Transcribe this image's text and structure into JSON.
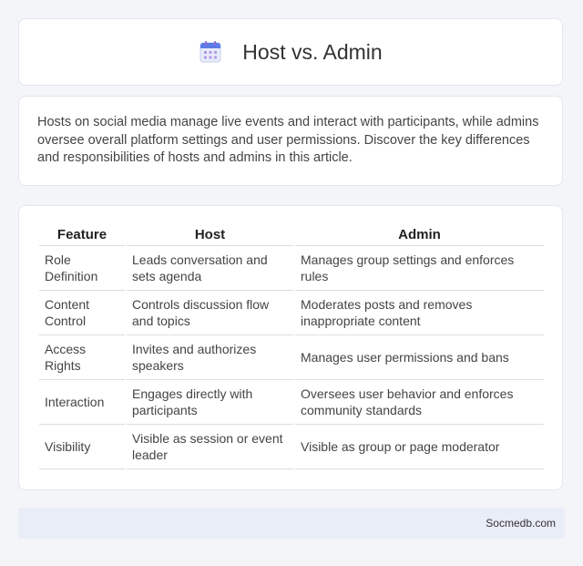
{
  "header": {
    "title": "Host vs. Admin",
    "icon": "calendar-icon"
  },
  "intro": {
    "text": "Hosts on social media manage live events and interact with participants, while admins oversee overall platform settings and user permissions. Discover the key differences and responsibilities of hosts and admins in this article."
  },
  "table": {
    "headers": [
      "Feature",
      "Host",
      "Admin"
    ],
    "rows": [
      [
        "Role Definition",
        "Leads conversation and sets agenda",
        "Manages group settings and enforces rules"
      ],
      [
        "Content Control",
        "Controls discussion flow and topics",
        "Moderates posts and removes inappropriate content"
      ],
      [
        "Access Rights",
        "Invites and authorizes speakers",
        "Manages user permissions and bans"
      ],
      [
        "Interaction",
        "Engages directly with participants",
        "Oversees user behavior and enforces community standards"
      ],
      [
        "Visibility",
        "Visible as session or event leader",
        "Visible as group or page moderator"
      ]
    ]
  },
  "footer": {
    "site": "Socmedb.com"
  },
  "colors": {
    "background": "#f3f5f9",
    "footer_bg": "#e9edf7",
    "icon_accent": "#5b7be8"
  }
}
